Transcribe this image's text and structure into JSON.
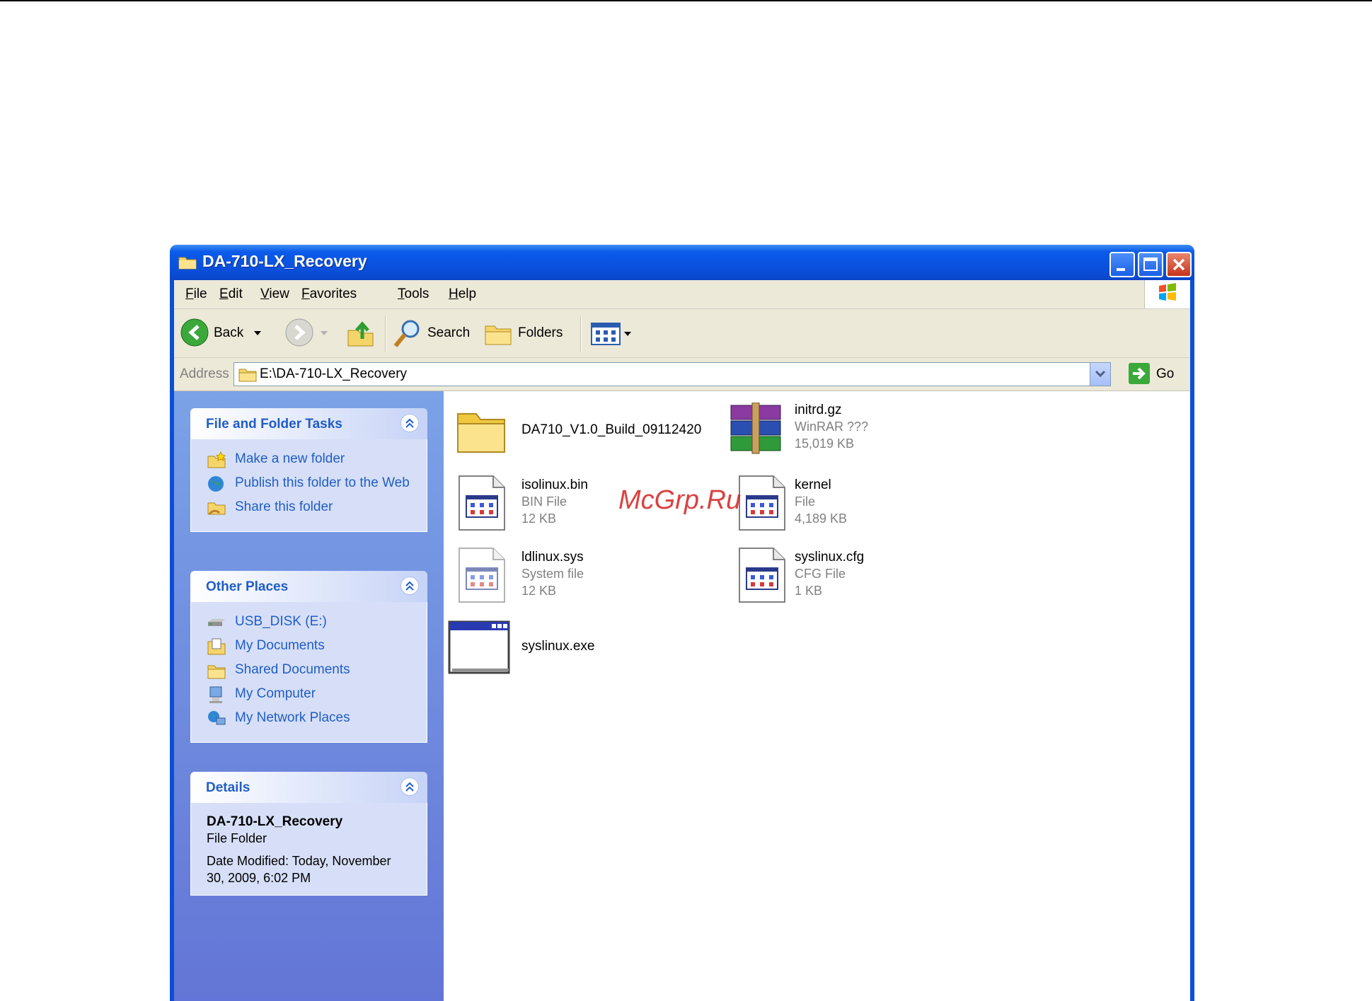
{
  "window": {
    "title": "DA-710-LX_Recovery"
  },
  "menu": [
    "File",
    "Edit",
    "View",
    "Favorites",
    "Tools",
    "Help"
  ],
  "toolbar": {
    "back": "Back",
    "search": "Search",
    "folders": "Folders"
  },
  "address": {
    "label": "Address",
    "path": "E:\\DA-710-LX_Recovery",
    "go": "Go"
  },
  "tasks_panel": {
    "title": "File and Folder Tasks",
    "items": [
      "Make a new folder",
      "Publish this folder to the Web",
      "Share this folder"
    ]
  },
  "places_panel": {
    "title": "Other Places",
    "items": [
      "USB_DISK (E:)",
      "My Documents",
      "Shared Documents",
      "My Computer",
      "My Network Places"
    ]
  },
  "details_panel": {
    "title": "Details",
    "name": "DA-710-LX_Recovery",
    "type": "File Folder",
    "modified": "Date Modified: Today, November 30, 2009, 6:02 PM"
  },
  "files": [
    {
      "name": "DA710_V1.0_Build_09112420",
      "type": "",
      "size": "",
      "icon": "folder-icon"
    },
    {
      "name": "initrd.gz",
      "type": "WinRAR ???",
      "size": "15,019 KB",
      "icon": "winrar-archive-icon"
    },
    {
      "name": "isolinux.bin",
      "type": "BIN File",
      "size": "12 KB",
      "icon": "file-icon"
    },
    {
      "name": "kernel",
      "type": "File",
      "size": "4,189 KB",
      "icon": "file-icon"
    },
    {
      "name": "ldlinux.sys",
      "type": "System file",
      "size": "12 KB",
      "icon": "system-file-icon"
    },
    {
      "name": "syslinux.cfg",
      "type": "CFG File",
      "size": "1 KB",
      "icon": "file-icon"
    },
    {
      "name": "syslinux.exe",
      "type": "",
      "size": "",
      "icon": "application-window-icon"
    }
  ],
  "watermark": "McGrp.Ru"
}
